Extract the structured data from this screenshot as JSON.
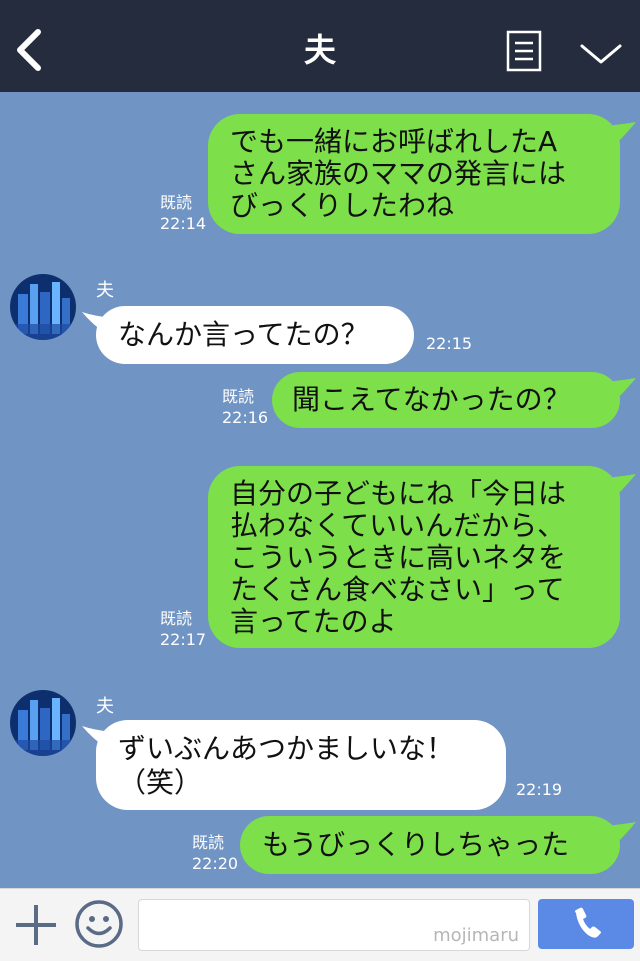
{
  "header": {
    "title": "夫"
  },
  "messages": [
    {
      "type": "outgoing",
      "text": "でも一緒にお呼ばれしたA\nさん家族のママの発言には\nびっくりしたわね",
      "read_label": "既読",
      "time": "22:14"
    },
    {
      "type": "incoming",
      "sender": "夫",
      "text": "なんか言ってたの？",
      "time": "22:15"
    },
    {
      "type": "outgoing",
      "text": "聞こえてなかったの？",
      "read_label": "既読",
      "time": "22:16"
    },
    {
      "type": "outgoing",
      "text": "自分の子どもにね「今日は\n払わなくていいんだから、\nこういうときに高いネタを\nたくさん食べなさい」って\n言ってたのよ",
      "read_label": "既読",
      "time": "22:17"
    },
    {
      "type": "incoming",
      "sender": "夫",
      "text": "ずいぶんあつかましいな！\n（笑）",
      "time": "22:19"
    },
    {
      "type": "outgoing",
      "text": "もうびっくりしちゃった",
      "read_label": "既読",
      "time": "22:20"
    }
  ],
  "input_bar": {
    "watermark": "mojimaru"
  },
  "colors": {
    "background": "#7094c4",
    "header": "#242c3d",
    "outgoing_bubble": "#7ddf4a",
    "incoming_bubble": "#ffffff",
    "call_button": "#5b8ae6"
  },
  "icons": [
    "back-icon",
    "menu-icon",
    "chevron-down-icon",
    "plus-icon",
    "smiley-icon",
    "phone-icon"
  ]
}
